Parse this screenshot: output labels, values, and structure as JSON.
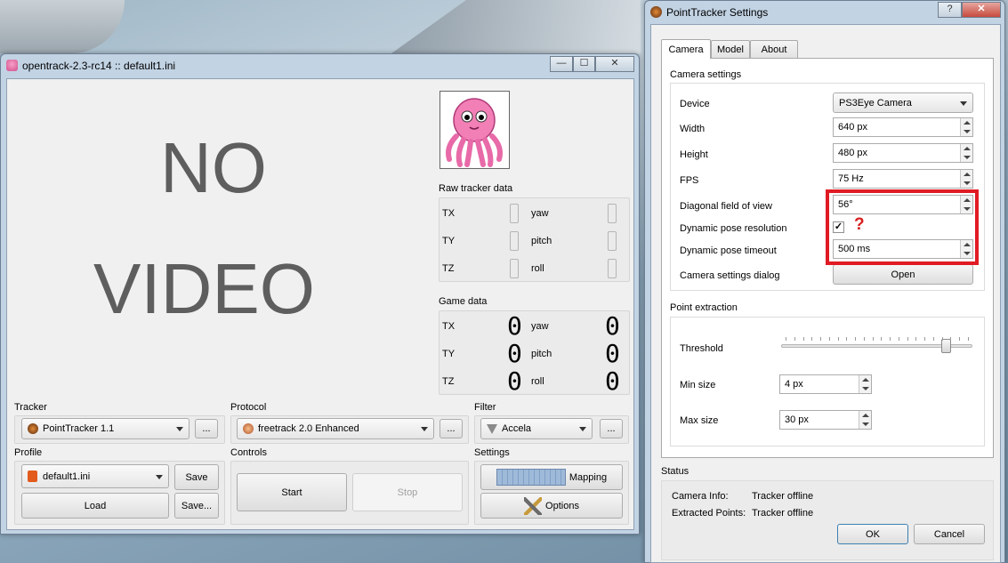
{
  "left_window": {
    "title": "opentrack-2.3-rc14 :: default1.ini",
    "video_placeholder": {
      "line1": "NO",
      "line2": "VIDEO"
    },
    "raw_tracker": {
      "title": "Raw tracker data",
      "labels": {
        "tx": "TX",
        "ty": "TY",
        "tz": "TZ",
        "yaw": "yaw",
        "pitch": "pitch",
        "roll": "roll"
      }
    },
    "game_data": {
      "title": "Game data",
      "labels": {
        "tx": "TX",
        "ty": "TY",
        "tz": "TZ",
        "yaw": "yaw",
        "pitch": "pitch",
        "roll": "roll"
      },
      "values": {
        "tx": "0",
        "ty": "0",
        "tz": "0",
        "yaw": "0",
        "pitch": "0",
        "roll": "0"
      }
    },
    "tracker": {
      "label": "Tracker",
      "selected": "PointTracker 1.1",
      "dots": "..."
    },
    "protocol": {
      "label": "Protocol",
      "selected": "freetrack 2.0 Enhanced",
      "dots": "..."
    },
    "filter": {
      "label": "Filter",
      "selected": "Accela",
      "dots": "..."
    },
    "profile": {
      "label": "Profile",
      "selected": "default1.ini",
      "save": "Save",
      "load": "Load",
      "save_as": "Save..."
    },
    "controls": {
      "label": "Controls",
      "start": "Start",
      "stop": "Stop"
    },
    "settings": {
      "label": "Settings",
      "mapping": "Mapping",
      "options": "Options"
    }
  },
  "right_window": {
    "title": "PointTracker Settings",
    "tabs": [
      "Camera",
      "Model",
      "About"
    ],
    "camera_settings": {
      "title": "Camera settings",
      "device_label": "Device",
      "device_value": "PS3Eye Camera",
      "width_label": "Width",
      "width_value": "640 px",
      "height_label": "Height",
      "height_value": "480 px",
      "fps_label": "FPS",
      "fps_value": "75 Hz",
      "fov_label": "Diagonal field of view",
      "fov_value": "56°",
      "dpr_label": "Dynamic pose resolution",
      "dpr_checked": "✓",
      "dpt_label": "Dynamic pose timeout",
      "dpt_value": "500 ms",
      "dialog_label": "Camera settings dialog",
      "open_button": "Open",
      "question_mark": "?"
    },
    "point_extraction": {
      "title": "Point extraction",
      "threshold_label": "Threshold",
      "threshold_level": 0.88,
      "min_size_label": "Min size",
      "min_size_value": "4 px",
      "max_size_label": "Max size",
      "max_size_value": "30 px"
    },
    "status": {
      "title": "Status",
      "camera_info_label": "Camera Info:",
      "camera_info_value": "Tracker offline",
      "extracted_label": "Extracted Points:",
      "extracted_value": "Tracker offline"
    },
    "ok_button": "OK",
    "cancel_button": "Cancel"
  },
  "title_buttons": {
    "minimize": "—",
    "maximize": "☐",
    "close": "✕",
    "help": "?"
  },
  "colors": {
    "highlight_box": "#e01b24",
    "question": "#d81e1e",
    "octopus": "#f27fb6"
  }
}
